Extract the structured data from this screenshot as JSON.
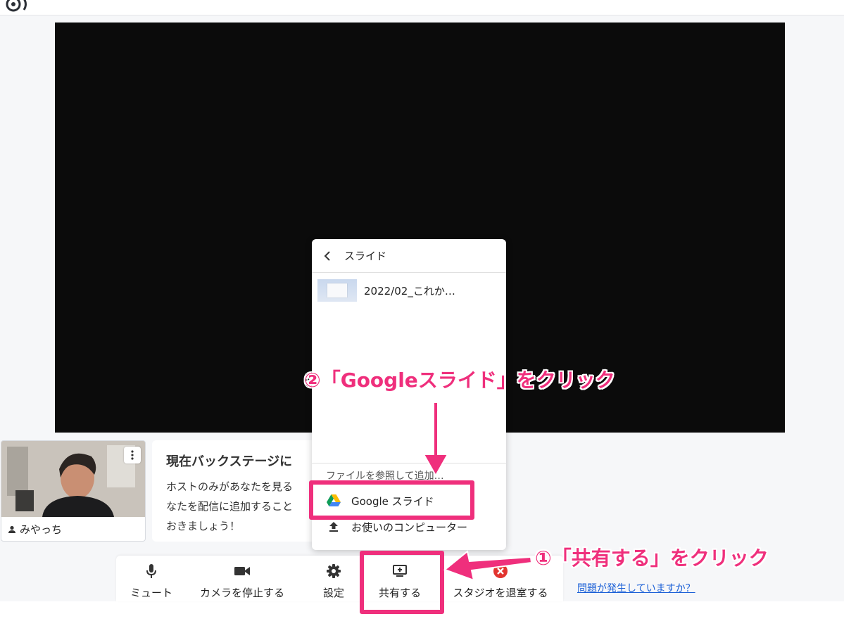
{
  "participant": {
    "name": "みやっち"
  },
  "backstage_notice": {
    "title": "現在バックステージに",
    "lines": [
      "ホストのみがあなたを見る",
      "なたを配信に追加すること",
      "おきましょう！"
    ]
  },
  "share_menu": {
    "back_label": "スライド",
    "slide_items": [
      {
        "name": "2022/02_これか…"
      }
    ],
    "browse_label": "ファイルを参照して追加…",
    "sources": [
      {
        "label": "Google スライド",
        "icon": "google-drive-icon"
      },
      {
        "label": "お使いのコンピューター",
        "icon": "upload-icon"
      }
    ]
  },
  "controls": [
    {
      "label": "ミュート",
      "icon": "microphone-icon"
    },
    {
      "label": "カメラを停止する",
      "icon": "camera-icon"
    },
    {
      "label": "設定",
      "icon": "gear-icon"
    },
    {
      "label": "共有する",
      "icon": "screen-share-icon"
    },
    {
      "label": "スタジオを退室する",
      "icon": "close-circle-icon"
    }
  ],
  "problem_link": "問題が発生していますか？",
  "annotations": {
    "step2": "②「Googleスライド」をクリック",
    "step1": "①「共有する」をクリック",
    "color": "#ef2f7c"
  },
  "colors": {
    "video_background": "#0b0b0b",
    "stage_background": "#f6f7f9",
    "link": "#1a5fd6",
    "leave_red": "#e2342f"
  }
}
